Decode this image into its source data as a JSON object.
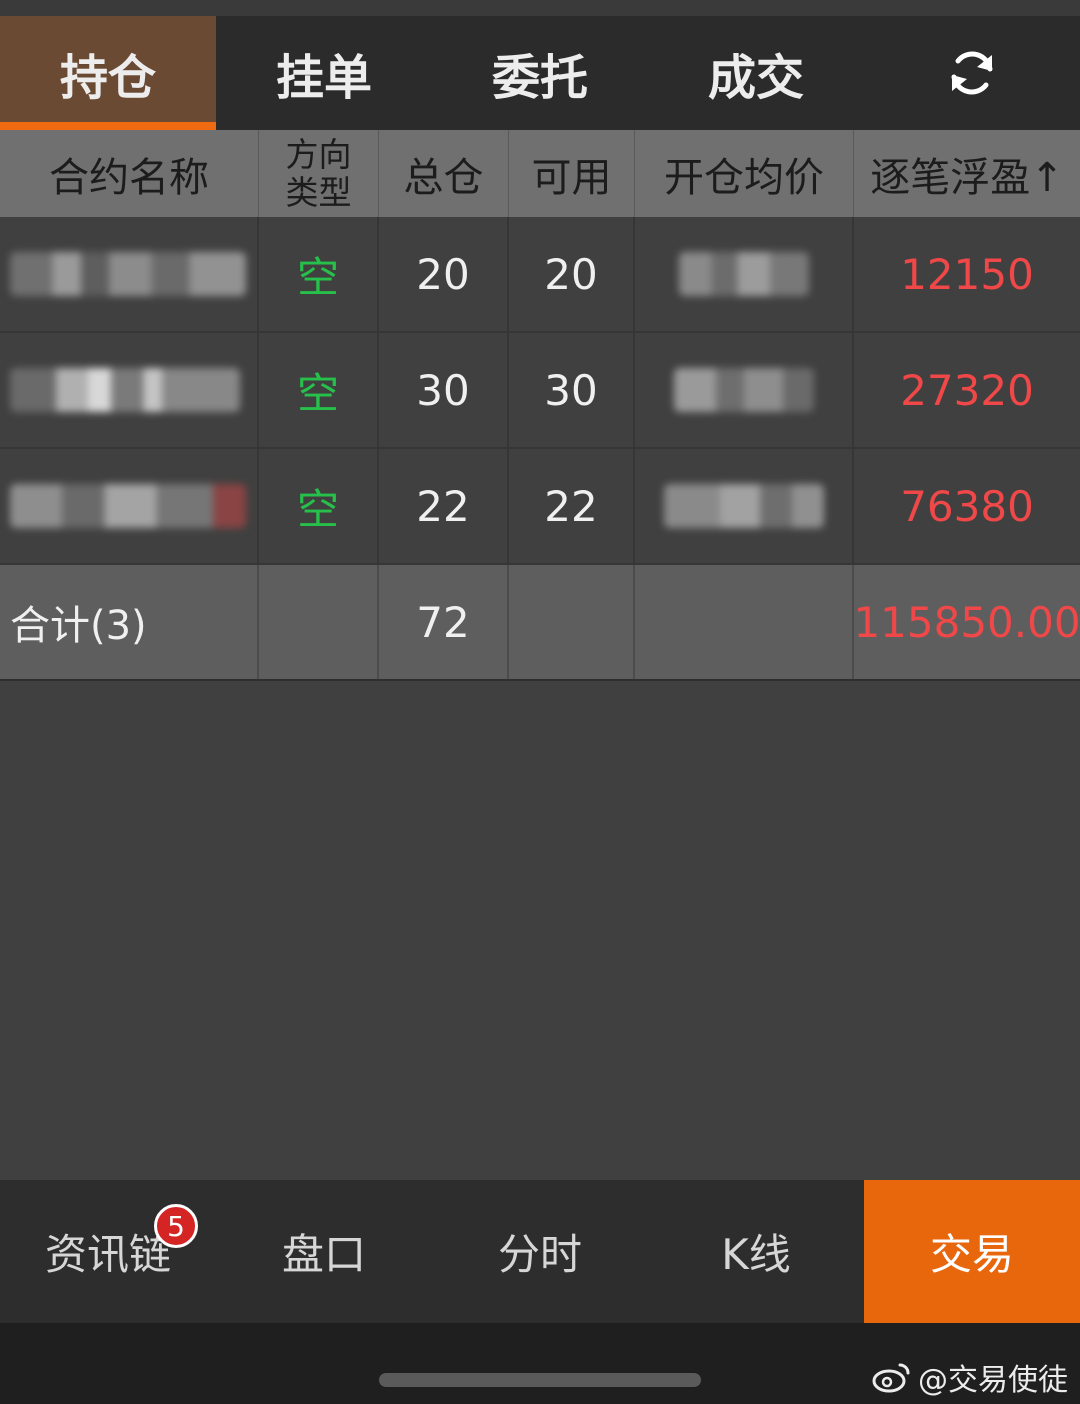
{
  "tabs": [
    {
      "label": "持仓",
      "active": true
    },
    {
      "label": "挂单",
      "active": false
    },
    {
      "label": "委托",
      "active": false
    },
    {
      "label": "成交",
      "active": false
    }
  ],
  "refresh_icon": "refresh-icon",
  "table": {
    "headers": [
      "合约名称",
      "方向类型",
      "总仓",
      "可用",
      "开仓均价",
      "逐笔浮盈↑"
    ],
    "rows": [
      {
        "direction": "空",
        "total": "20",
        "available": "20",
        "profit": "12150"
      },
      {
        "direction": "空",
        "total": "30",
        "available": "30",
        "profit": "27320"
      },
      {
        "direction": "空",
        "total": "22",
        "available": "22",
        "profit": "76380"
      }
    ],
    "summary": {
      "label": "合计(3)",
      "total": "72",
      "profit": "115850.00"
    }
  },
  "bottom_nav": {
    "items": [
      "资讯链",
      "盘口",
      "分时",
      "K线",
      "交易"
    ],
    "badge": "5"
  },
  "watermark": {
    "text": "@交易使徒",
    "icon": "weibo-icon"
  },
  "colors": {
    "accent": "#e8660c",
    "profit": "#f04848",
    "short": "#26c04a",
    "active_tab": "#6b4a33"
  }
}
